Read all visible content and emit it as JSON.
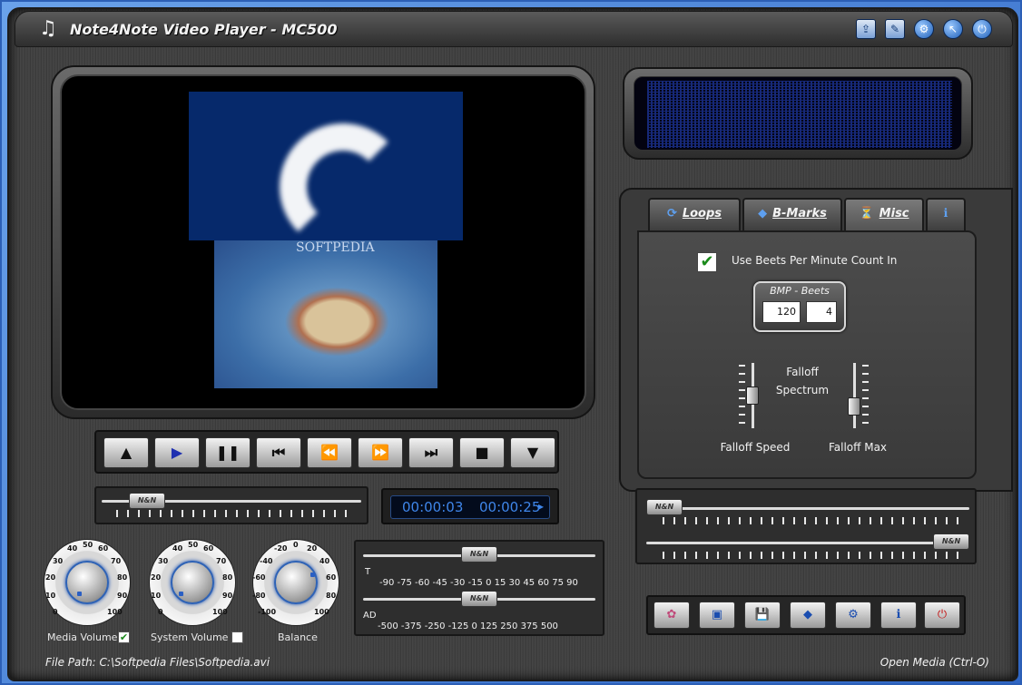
{
  "window": {
    "title": "Note4Note Video Player - MC500",
    "logo_icon": "note4note-logo",
    "title_icons": [
      "export-icon",
      "edit-icon",
      "settings-icon",
      "help-pointer-icon",
      "power-icon"
    ]
  },
  "video": {
    "watermark": "SOFTPEDIA"
  },
  "transport": {
    "buttons": [
      "▲",
      "▶",
      "❚❚",
      "⏮",
      "⏪",
      "⏩",
      "⏭",
      "■",
      "▼"
    ],
    "seek_thumb_label": "N&N"
  },
  "time": {
    "current": "00:00:03",
    "total": "00:00:25",
    "arrow": "▸"
  },
  "knobs": {
    "media_volume": {
      "label": "Media Volume",
      "checked": true,
      "scale": [
        "0",
        "10",
        "20",
        "30",
        "40",
        "50",
        "60",
        "70",
        "80",
        "90",
        "100"
      ]
    },
    "system_volume": {
      "label": "System Volume",
      "checked": false,
      "scale": [
        "0",
        "10",
        "20",
        "30",
        "40",
        "50",
        "60",
        "70",
        "80",
        "90",
        "100"
      ]
    },
    "balance": {
      "label": "Balance",
      "scale": [
        "-100",
        "-80",
        "-60",
        "-40",
        "-20",
        "0",
        "20",
        "40",
        "60",
        "80",
        "100"
      ]
    }
  },
  "equalizer": {
    "t_letter": "T",
    "t_scale": "-90 -75 -60 -45 -30 -15  0  15  30  45  60  75  90",
    "ad_letter": "AD",
    "ad_scale": "-500 -375 -250 -125  0  125  250  375  500",
    "thumb_label": "N&N"
  },
  "tabs": [
    {
      "label": "Loops",
      "icon": "loop-icon"
    },
    {
      "label": "B-Marks",
      "icon": "bookmark-icon"
    },
    {
      "label": "Misc",
      "icon": "metronome-icon"
    },
    {
      "label": "",
      "icon": "info-icon"
    }
  ],
  "misc": {
    "checkbox_label": "Use Beets Per Minute Count In",
    "checkbox_checked": true,
    "bmp_title": "BMP - Beets",
    "bmp_value": "120",
    "beets_value": "4",
    "falloff_spectrum": "Falloff\nSpectrum",
    "falloff_speed": "Falloff Speed",
    "falloff_max": "Falloff Max"
  },
  "right_sliders": {
    "thumb_label": "N&N"
  },
  "utility_buttons": [
    "color-icon",
    "monitor-icon",
    "save-icon",
    "bookmark-icon",
    "settings-icon",
    "info-icon",
    "power-icon"
  ],
  "status": {
    "file_path": "File Path: C:\\Softpedia Files\\Softpedia.avi",
    "open_media": "Open Media (Ctrl-O)"
  }
}
